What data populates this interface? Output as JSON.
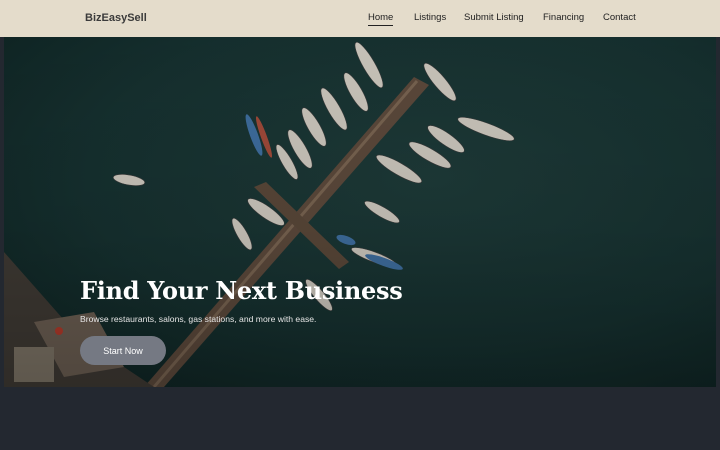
{
  "header": {
    "brand": "BizEasySell",
    "nav": [
      {
        "label": "Home",
        "active": true
      },
      {
        "label": "Listings",
        "active": false
      },
      {
        "label": "Submit Listing",
        "active": false
      },
      {
        "label": "Financing",
        "active": false
      },
      {
        "label": "Contact",
        "active": false
      }
    ]
  },
  "hero": {
    "title": "Find Your Next Business",
    "subtitle": "Browse restaurants, salons, gas stations, and more with ease.",
    "cta_label": "Start Now"
  },
  "colors": {
    "header_bg": "#e4dccb",
    "cta_bg": "#757983",
    "page_bg": "#232830",
    "water": "#15302f"
  }
}
